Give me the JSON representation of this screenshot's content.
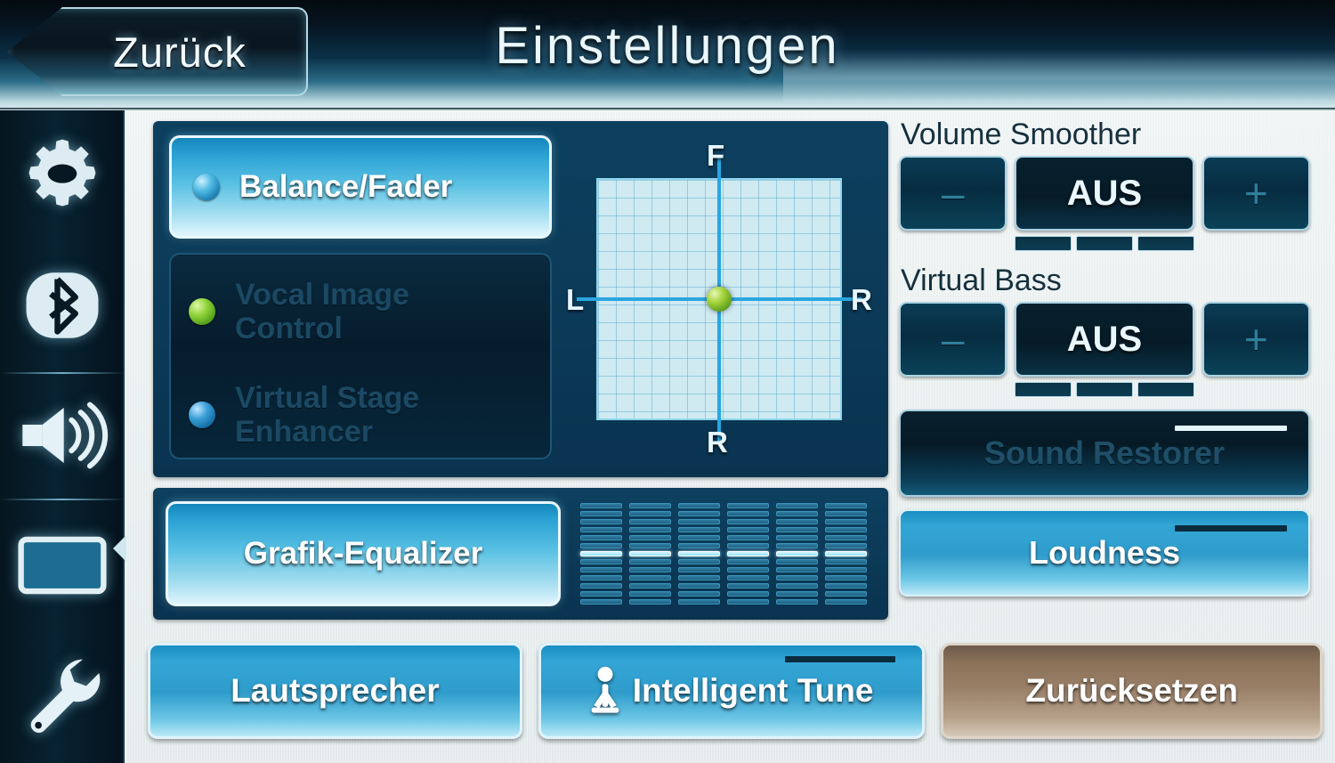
{
  "header": {
    "back_label": "Zurück",
    "back_icon": "chevron-left-icon",
    "title": "Einstellungen"
  },
  "sidebar": {
    "items": [
      {
        "icon": "gear-icon",
        "name": "settings",
        "selected": false
      },
      {
        "icon": "bluetooth-icon",
        "name": "bluetooth",
        "selected": false
      },
      {
        "icon": "speaker-volume-icon",
        "name": "sound",
        "selected": true
      },
      {
        "icon": "display-screen-icon",
        "name": "display",
        "selected": false
      },
      {
        "icon": "wrench-icon",
        "name": "tools",
        "selected": false
      }
    ]
  },
  "sound_modes": {
    "balance_fader": {
      "label": "Balance/Fader",
      "bullet": "cyan",
      "active": true
    },
    "vocal_image_control": {
      "label": "Vocal Image\nControl",
      "line1": "Vocal Image",
      "line2": "Control",
      "bullet": "green",
      "active": false
    },
    "virtual_stage_enhancer": {
      "label": "Virtual Stage\nEnhancer",
      "line1": "Virtual Stage",
      "line2": "Enhancer",
      "bullet": "blue",
      "active": false
    }
  },
  "balance_pad": {
    "label_front": "F",
    "label_rear": "R",
    "label_left": "L",
    "label_right": "R",
    "position_x": 0,
    "position_y": 0,
    "dot_color": "#8fd33a"
  },
  "equalizer": {
    "button_label": "Grafik-Equalizer",
    "bands": 6,
    "segments_per_band": 13,
    "active_segment_index": 6,
    "values": [
      0,
      0,
      0,
      0,
      0,
      0
    ]
  },
  "right_controls": {
    "volume_smoother": {
      "label": "Volume Smoother",
      "value": "AUS",
      "minus_label": "–",
      "plus_label": "+",
      "segments": [
        0,
        0,
        0
      ]
    },
    "virtual_bass": {
      "label": "Virtual Bass",
      "value": "AUS",
      "minus_label": "–",
      "plus_label": "+",
      "segments": [
        0,
        0,
        0
      ]
    },
    "sound_restorer": {
      "label": "Sound Restorer",
      "active": false
    },
    "loudness": {
      "label": "Loudness",
      "active": true
    }
  },
  "bottom_buttons": {
    "speaker": {
      "label": "Lautsprecher"
    },
    "intelligent_tune": {
      "label": "Intelligent Tune",
      "icon": "person-icon"
    },
    "reset": {
      "label": "Zurücksetzen"
    }
  },
  "colors": {
    "accent": "#2ba2d4",
    "panel_dark": "#0d405f",
    "reset_brown": "#9a8068",
    "background": "#e8eff0"
  }
}
